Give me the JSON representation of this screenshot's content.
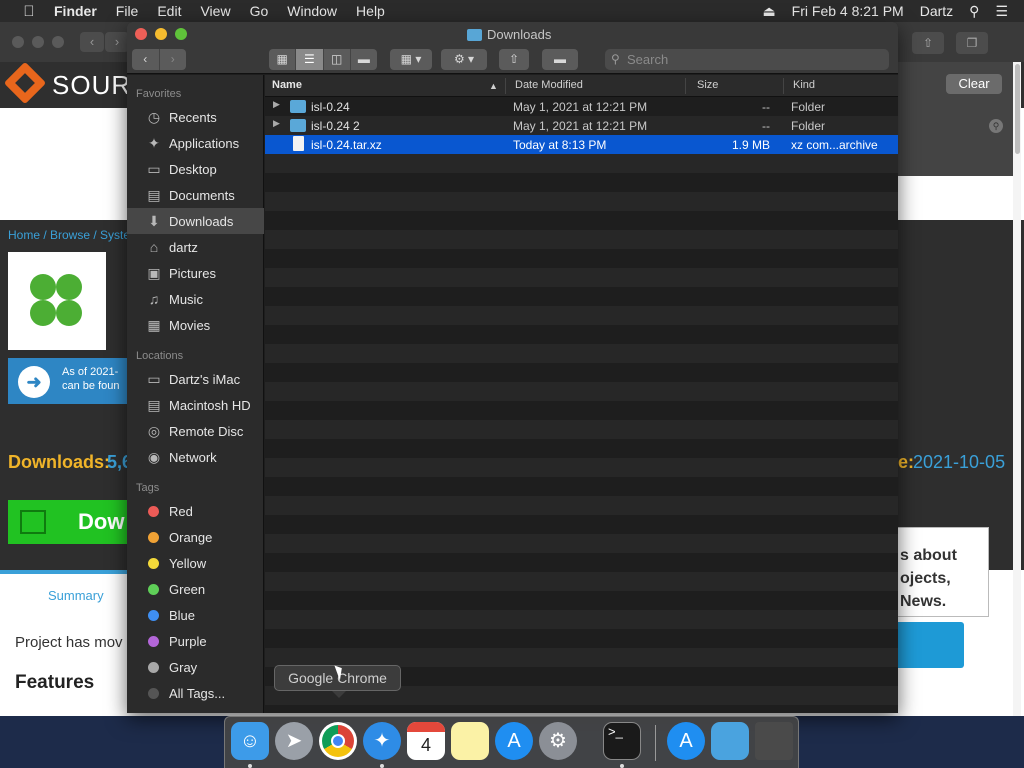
{
  "menubar": {
    "app": "Finder",
    "items": [
      "File",
      "Edit",
      "View",
      "Go",
      "Window",
      "Help"
    ],
    "datetime": "Fri Feb 4  8:21 PM",
    "user": "Dartz"
  },
  "browser": {
    "logo_text": "SOURC",
    "clear_label": "Clear",
    "breadcrumb": "Home / Browse / Syste",
    "notice_line1": "As of 2021-",
    "notice_line2": "can be foun",
    "downloads_label": "Downloads:",
    "downloads_count": "5,6",
    "date_label": "e:",
    "date_value": "2021-10-05",
    "download_button": "Dow",
    "summary_tab": "Summary",
    "project_text": "Project has mov",
    "features_heading": "Features",
    "news_line1": "s about",
    "news_line2": "ojects,",
    "news_line3": "News."
  },
  "finder": {
    "title": "Downloads",
    "search_placeholder": "Search",
    "sidebar": {
      "favorites_header": "Favorites",
      "favorites": [
        {
          "label": "Recents",
          "icon": "clock-icon"
        },
        {
          "label": "Applications",
          "icon": "applications-icon"
        },
        {
          "label": "Desktop",
          "icon": "desktop-icon"
        },
        {
          "label": "Documents",
          "icon": "documents-icon"
        },
        {
          "label": "Downloads",
          "icon": "downloads-icon"
        },
        {
          "label": "dartz",
          "icon": "home-icon"
        },
        {
          "label": "Pictures",
          "icon": "camera-icon"
        },
        {
          "label": "Music",
          "icon": "music-icon"
        },
        {
          "label": "Movies",
          "icon": "film-icon"
        }
      ],
      "locations_header": "Locations",
      "locations": [
        {
          "label": "Dartz's iMac",
          "icon": "imac-icon"
        },
        {
          "label": "Macintosh HD",
          "icon": "hard-drive-icon"
        },
        {
          "label": "Remote Disc",
          "icon": "disc-icon"
        },
        {
          "label": "Network",
          "icon": "globe-icon"
        }
      ],
      "tags_header": "Tags",
      "tags": [
        {
          "label": "Red",
          "color": "#ec5b57"
        },
        {
          "label": "Orange",
          "color": "#f0a235"
        },
        {
          "label": "Yellow",
          "color": "#f3d93a"
        },
        {
          "label": "Green",
          "color": "#5fcf58"
        },
        {
          "label": "Blue",
          "color": "#3f8ff2"
        },
        {
          "label": "Purple",
          "color": "#b366d8"
        },
        {
          "label": "Gray",
          "color": "#a8a8a8"
        },
        {
          "label": "All Tags...",
          "color": "#555555"
        }
      ]
    },
    "columns": {
      "name": "Name",
      "date": "Date Modified",
      "size": "Size",
      "kind": "Kind"
    },
    "files": [
      {
        "name": "isl-0.24",
        "date": "May 1, 2021 at 12:21 PM",
        "size": "--",
        "kind": "Folder",
        "type": "folder"
      },
      {
        "name": "isl-0.24 2",
        "date": "May 1, 2021 at 12:21 PM",
        "size": "--",
        "kind": "Folder",
        "type": "folder"
      },
      {
        "name": "isl-0.24.tar.xz",
        "date": "Today at 8:13 PM",
        "size": "1.9 MB",
        "kind": "xz com...archive",
        "type": "archive",
        "selected": true
      }
    ]
  },
  "tooltip": "Google Chrome",
  "colors": {
    "selection": "#0957d0",
    "accent_blue": "#3aa0d8"
  }
}
